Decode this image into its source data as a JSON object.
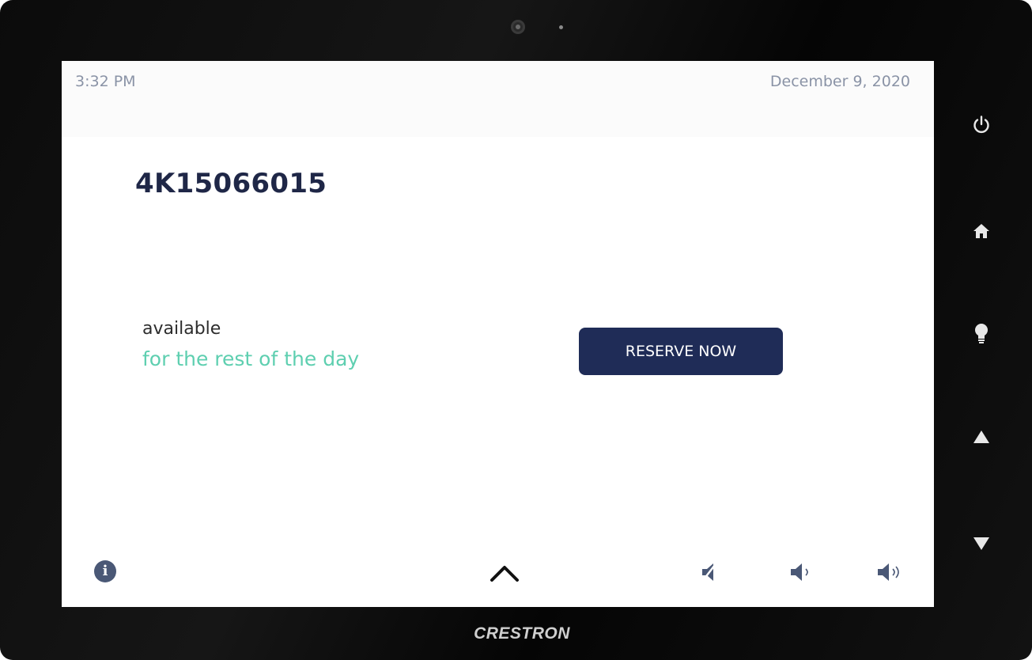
{
  "status_bar": {
    "time": "3:32 PM",
    "date": "December 9, 2020"
  },
  "room": {
    "name": "4K15066015"
  },
  "availability": {
    "status": "available",
    "detail": "for the rest of the day"
  },
  "actions": {
    "reserve_label": "RESERVE NOW"
  },
  "bottom_bar": {
    "icons": [
      "info-icon",
      "chevron-up-icon",
      "volume-mute-icon",
      "volume-down-icon",
      "volume-up-icon"
    ]
  },
  "device": {
    "brand": "CRESTRON",
    "side_buttons": [
      "power-icon",
      "home-icon",
      "lightbulb-icon",
      "arrow-up-icon",
      "arrow-down-icon"
    ]
  },
  "colors": {
    "accent_navy": "#1f2c57",
    "available_green": "#5ecfb0",
    "muted_text": "#8a93a6"
  }
}
